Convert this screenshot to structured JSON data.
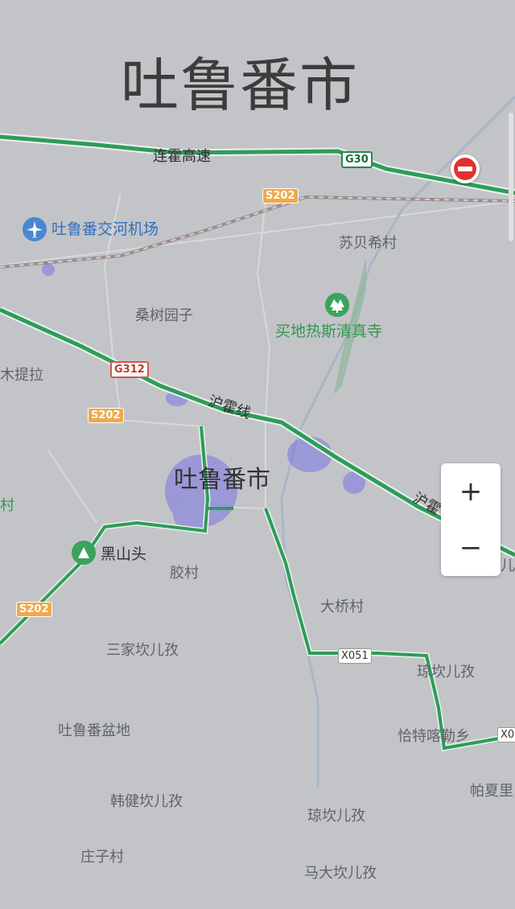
{
  "map": {
    "city_title_large": "吐鲁番市",
    "city_label": "吐鲁番市",
    "roads": {
      "expressway": "连霍高速",
      "railway": "沪霍线",
      "railway_partial": "沪霍"
    },
    "shields": {
      "g30": "G30",
      "g312": "G312",
      "s202_a": "S202",
      "s202_b": "S202",
      "s202_c": "S202",
      "x051": "X051",
      "x05_partial": "X0"
    },
    "pois": {
      "airport": "吐鲁番交河机场",
      "mosque": "买地热斯清真寺",
      "heishantou": "黑山头"
    },
    "places": {
      "subeixi": "苏贝希村",
      "sangshuyuanzi": "桑树园子",
      "mutila_partial": "木提拉",
      "cun_partial": "村",
      "jiaocun": "胶村",
      "daqiaocun": "大桥村",
      "sanjiakanerzi": "三家坎儿孜",
      "qiongkanerzi_1": "琼坎儿孜",
      "qiateqalexiang": "恰特喀勒乡",
      "basin": "吐鲁番盆地",
      "pazhali_partial": "帕夏里",
      "hanjiankanerzi": "韩健坎儿孜",
      "qiongkanerzi_2": "琼坎儿孜",
      "zhuangzicun": "庄子村",
      "madakanerzi": "马大坎儿孜",
      "er_partial": "儿"
    },
    "zoom": {
      "in": "+",
      "out": "−"
    }
  },
  "colors": {
    "background": "#c3c4c8",
    "highway_green": "#2f9b5a",
    "highway_edge": "#e9f3ec",
    "railway": "#9a8f8f",
    "river": "#a9b6c9",
    "vegetation": "#8fb79a",
    "heat_purple": "#6a63e8",
    "shield_orange": "#f0a94a"
  }
}
